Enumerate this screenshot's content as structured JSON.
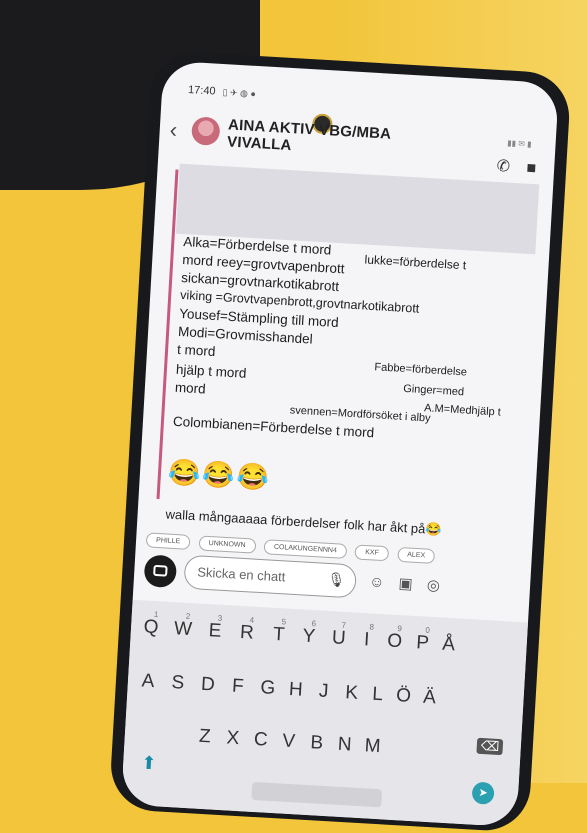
{
  "status_time": "17:40",
  "chat": {
    "title_line1": "AINA AKTIV VBG/MBA",
    "title_line2": "VIVALLA"
  },
  "note_lines": [
    "Alka=Förberdelse t mord",
    "lukke=förberdelse t",
    "mord reey=grovtvapenbrott",
    "sickan=grovtnarkotikabrott",
    "viking =Grovtvapenbrott,grovtnarkotikabrott",
    "Yousef=Stämpling till mord",
    "Modi=Grovmisshandel",
    "t mord",
    "Fabbe=förberdelse",
    "hjälp t mord",
    "Ginger=med",
    "mord",
    "A.M=Medhjälp t",
    "svennen=Mordförsöket i alby",
    "Colombianen=Förberdelse t mord"
  ],
  "emojis": "😂😂😂",
  "reply": "walla mångaaaaa förberdelser folk har åkt på😂",
  "chips": [
    "PHILLE",
    "UNKNOWN",
    "COLAKUNGENNN4",
    "KXF",
    "ALEX"
  ],
  "input_placeholder": "Skicka en chatt",
  "keyboard": {
    "row1": [
      "Q",
      "W",
      "E",
      "R",
      "T",
      "Y",
      "U",
      "I",
      "O",
      "P",
      "Å"
    ],
    "row1_nums": [
      "1",
      "2",
      "3",
      "4",
      "5",
      "6",
      "7",
      "8",
      "9",
      "0",
      ""
    ],
    "row2": [
      "A",
      "S",
      "D",
      "F",
      "G",
      "H",
      "J",
      "K",
      "L",
      "Ö",
      "Ä"
    ],
    "row3": [
      "Z",
      "X",
      "C",
      "V",
      "B",
      "N",
      "M"
    ]
  }
}
